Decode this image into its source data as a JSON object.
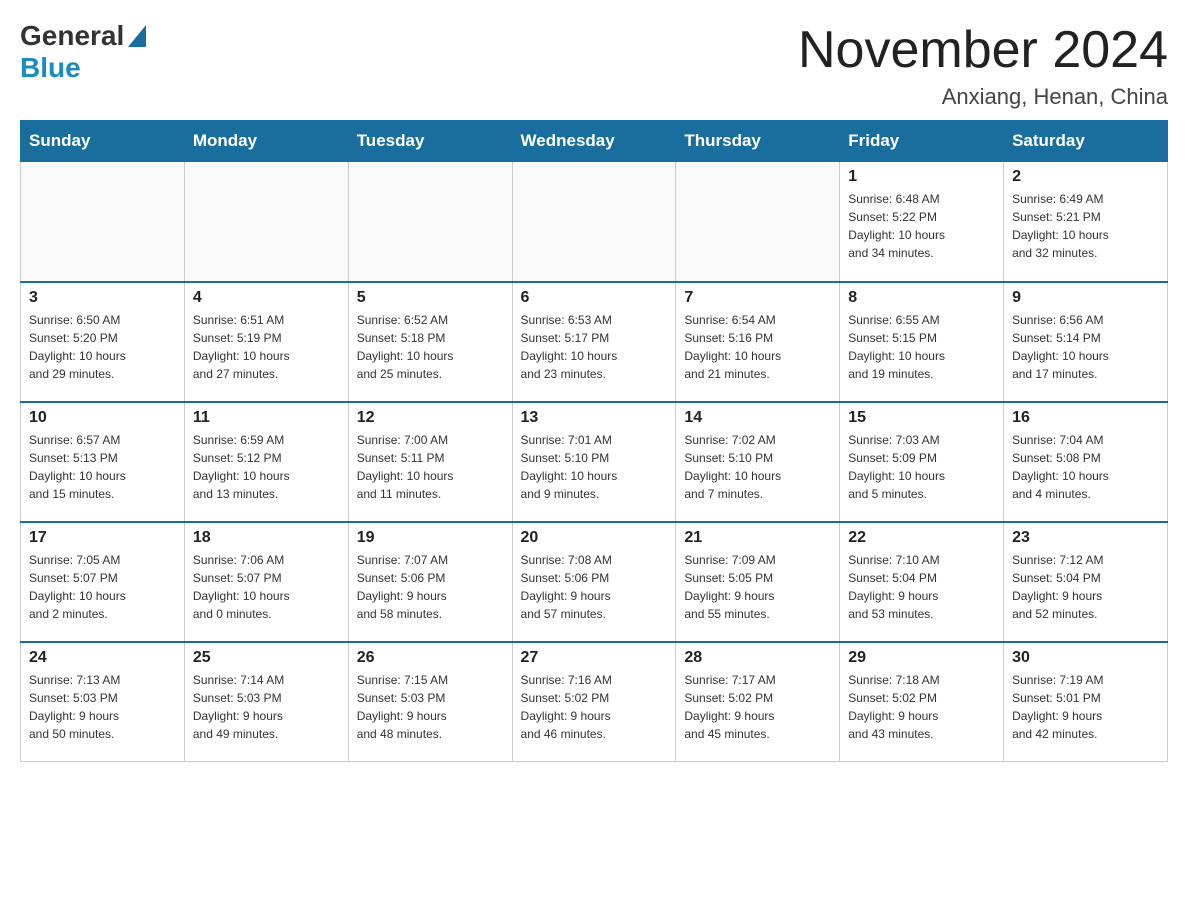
{
  "logo": {
    "general": "General",
    "blue": "Blue"
  },
  "title": "November 2024",
  "location": "Anxiang, Henan, China",
  "days_of_week": [
    "Sunday",
    "Monday",
    "Tuesday",
    "Wednesday",
    "Thursday",
    "Friday",
    "Saturday"
  ],
  "weeks": [
    [
      {
        "day": "",
        "info": ""
      },
      {
        "day": "",
        "info": ""
      },
      {
        "day": "",
        "info": ""
      },
      {
        "day": "",
        "info": ""
      },
      {
        "day": "",
        "info": ""
      },
      {
        "day": "1",
        "info": "Sunrise: 6:48 AM\nSunset: 5:22 PM\nDaylight: 10 hours\nand 34 minutes."
      },
      {
        "day": "2",
        "info": "Sunrise: 6:49 AM\nSunset: 5:21 PM\nDaylight: 10 hours\nand 32 minutes."
      }
    ],
    [
      {
        "day": "3",
        "info": "Sunrise: 6:50 AM\nSunset: 5:20 PM\nDaylight: 10 hours\nand 29 minutes."
      },
      {
        "day": "4",
        "info": "Sunrise: 6:51 AM\nSunset: 5:19 PM\nDaylight: 10 hours\nand 27 minutes."
      },
      {
        "day": "5",
        "info": "Sunrise: 6:52 AM\nSunset: 5:18 PM\nDaylight: 10 hours\nand 25 minutes."
      },
      {
        "day": "6",
        "info": "Sunrise: 6:53 AM\nSunset: 5:17 PM\nDaylight: 10 hours\nand 23 minutes."
      },
      {
        "day": "7",
        "info": "Sunrise: 6:54 AM\nSunset: 5:16 PM\nDaylight: 10 hours\nand 21 minutes."
      },
      {
        "day": "8",
        "info": "Sunrise: 6:55 AM\nSunset: 5:15 PM\nDaylight: 10 hours\nand 19 minutes."
      },
      {
        "day": "9",
        "info": "Sunrise: 6:56 AM\nSunset: 5:14 PM\nDaylight: 10 hours\nand 17 minutes."
      }
    ],
    [
      {
        "day": "10",
        "info": "Sunrise: 6:57 AM\nSunset: 5:13 PM\nDaylight: 10 hours\nand 15 minutes."
      },
      {
        "day": "11",
        "info": "Sunrise: 6:59 AM\nSunset: 5:12 PM\nDaylight: 10 hours\nand 13 minutes."
      },
      {
        "day": "12",
        "info": "Sunrise: 7:00 AM\nSunset: 5:11 PM\nDaylight: 10 hours\nand 11 minutes."
      },
      {
        "day": "13",
        "info": "Sunrise: 7:01 AM\nSunset: 5:10 PM\nDaylight: 10 hours\nand 9 minutes."
      },
      {
        "day": "14",
        "info": "Sunrise: 7:02 AM\nSunset: 5:10 PM\nDaylight: 10 hours\nand 7 minutes."
      },
      {
        "day": "15",
        "info": "Sunrise: 7:03 AM\nSunset: 5:09 PM\nDaylight: 10 hours\nand 5 minutes."
      },
      {
        "day": "16",
        "info": "Sunrise: 7:04 AM\nSunset: 5:08 PM\nDaylight: 10 hours\nand 4 minutes."
      }
    ],
    [
      {
        "day": "17",
        "info": "Sunrise: 7:05 AM\nSunset: 5:07 PM\nDaylight: 10 hours\nand 2 minutes."
      },
      {
        "day": "18",
        "info": "Sunrise: 7:06 AM\nSunset: 5:07 PM\nDaylight: 10 hours\nand 0 minutes."
      },
      {
        "day": "19",
        "info": "Sunrise: 7:07 AM\nSunset: 5:06 PM\nDaylight: 9 hours\nand 58 minutes."
      },
      {
        "day": "20",
        "info": "Sunrise: 7:08 AM\nSunset: 5:06 PM\nDaylight: 9 hours\nand 57 minutes."
      },
      {
        "day": "21",
        "info": "Sunrise: 7:09 AM\nSunset: 5:05 PM\nDaylight: 9 hours\nand 55 minutes."
      },
      {
        "day": "22",
        "info": "Sunrise: 7:10 AM\nSunset: 5:04 PM\nDaylight: 9 hours\nand 53 minutes."
      },
      {
        "day": "23",
        "info": "Sunrise: 7:12 AM\nSunset: 5:04 PM\nDaylight: 9 hours\nand 52 minutes."
      }
    ],
    [
      {
        "day": "24",
        "info": "Sunrise: 7:13 AM\nSunset: 5:03 PM\nDaylight: 9 hours\nand 50 minutes."
      },
      {
        "day": "25",
        "info": "Sunrise: 7:14 AM\nSunset: 5:03 PM\nDaylight: 9 hours\nand 49 minutes."
      },
      {
        "day": "26",
        "info": "Sunrise: 7:15 AM\nSunset: 5:03 PM\nDaylight: 9 hours\nand 48 minutes."
      },
      {
        "day": "27",
        "info": "Sunrise: 7:16 AM\nSunset: 5:02 PM\nDaylight: 9 hours\nand 46 minutes."
      },
      {
        "day": "28",
        "info": "Sunrise: 7:17 AM\nSunset: 5:02 PM\nDaylight: 9 hours\nand 45 minutes."
      },
      {
        "day": "29",
        "info": "Sunrise: 7:18 AM\nSunset: 5:02 PM\nDaylight: 9 hours\nand 43 minutes."
      },
      {
        "day": "30",
        "info": "Sunrise: 7:19 AM\nSunset: 5:01 PM\nDaylight: 9 hours\nand 42 minutes."
      }
    ]
  ]
}
